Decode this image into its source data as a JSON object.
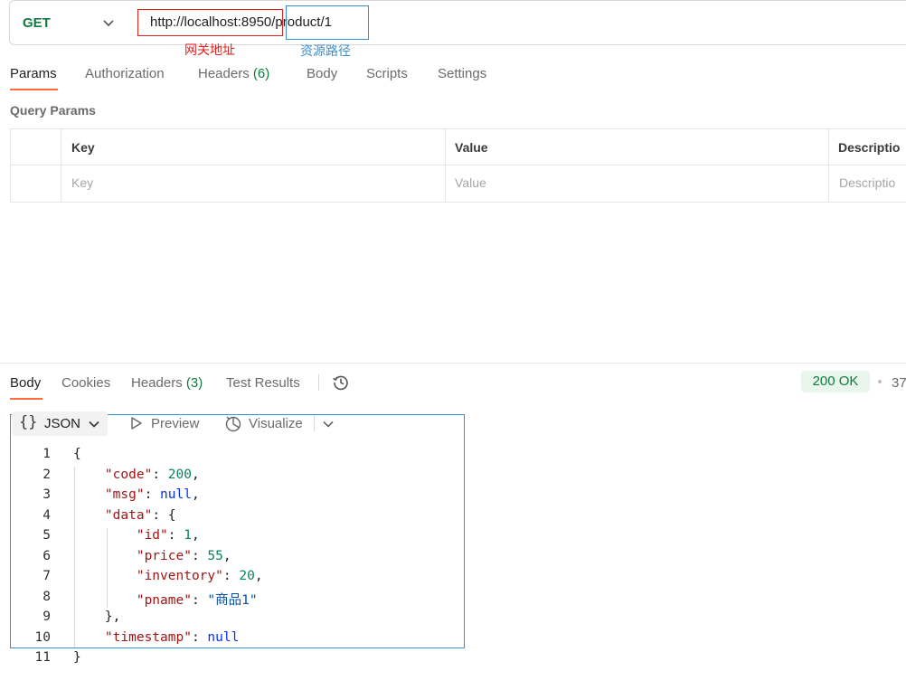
{
  "request": {
    "method": "GET",
    "url": "http://localhost:8950/product/1",
    "annotations": {
      "host_label": "网关地址",
      "path_label": "资源路径",
      "host_color": "#e0211e",
      "path_color": "#3a8fd0"
    }
  },
  "request_tabs": {
    "params": "Params",
    "authorization": "Authorization",
    "headers": "Headers",
    "headers_count": "(6)",
    "body": "Body",
    "scripts": "Scripts",
    "settings": "Settings"
  },
  "query_params": {
    "title": "Query Params",
    "columns": {
      "key": "Key",
      "value": "Value",
      "description": "Descriptio"
    },
    "placeholders": {
      "key": "Key",
      "value": "Value",
      "description": "Descriptio"
    }
  },
  "response": {
    "tabs": {
      "body": "Body",
      "cookies": "Cookies",
      "headers": "Headers",
      "headers_count": "(3)",
      "test_results": "Test Results"
    },
    "status": "200 OK",
    "time": "37",
    "toolbar": {
      "format_braces": "{}",
      "format": "JSON",
      "preview": "Preview",
      "visualize": "Visualize"
    },
    "lines": [
      {
        "n": "1",
        "tokens": [
          [
            "p",
            "{"
          ]
        ]
      },
      {
        "n": "2",
        "tokens": [
          [
            "p",
            "    "
          ],
          [
            "k",
            "\"code\""
          ],
          [
            "p",
            ": "
          ],
          [
            "n",
            "200"
          ],
          [
            "p",
            ","
          ]
        ]
      },
      {
        "n": "3",
        "tokens": [
          [
            "p",
            "    "
          ],
          [
            "k",
            "\"msg\""
          ],
          [
            "p",
            ": "
          ],
          [
            "kw",
            "null"
          ],
          [
            "p",
            ","
          ]
        ]
      },
      {
        "n": "4",
        "tokens": [
          [
            "p",
            "    "
          ],
          [
            "k",
            "\"data\""
          ],
          [
            "p",
            ": {"
          ]
        ]
      },
      {
        "n": "5",
        "tokens": [
          [
            "p",
            "        "
          ],
          [
            "k",
            "\"id\""
          ],
          [
            "p",
            ": "
          ],
          [
            "n",
            "1"
          ],
          [
            "p",
            ","
          ]
        ]
      },
      {
        "n": "6",
        "tokens": [
          [
            "p",
            "        "
          ],
          [
            "k",
            "\"price\""
          ],
          [
            "p",
            ": "
          ],
          [
            "n",
            "55"
          ],
          [
            "p",
            ","
          ]
        ]
      },
      {
        "n": "7",
        "tokens": [
          [
            "p",
            "        "
          ],
          [
            "k",
            "\"inventory\""
          ],
          [
            "p",
            ": "
          ],
          [
            "n",
            "20"
          ],
          [
            "p",
            ","
          ]
        ]
      },
      {
        "n": "8",
        "tokens": [
          [
            "p",
            "        "
          ],
          [
            "k",
            "\"pname\""
          ],
          [
            "p",
            ": "
          ],
          [
            "s",
            "\"商品1\""
          ]
        ]
      },
      {
        "n": "9",
        "tokens": [
          [
            "p",
            "    },"
          ]
        ]
      },
      {
        "n": "10",
        "tokens": [
          [
            "p",
            "    "
          ],
          [
            "k",
            "\"timestamp\""
          ],
          [
            "p",
            ": "
          ],
          [
            "kw",
            "null"
          ]
        ]
      },
      {
        "n": "11",
        "tokens": [
          [
            "p",
            "}"
          ]
        ]
      }
    ]
  },
  "colors": {
    "accent": "#ff6c37",
    "success": "#0f7b3f",
    "annotation_red": "#e0211e",
    "annotation_blue": "#3a8fd0"
  },
  "icons": [
    "chevron-down-icon",
    "history-icon",
    "play-icon",
    "visualize-icon"
  ]
}
